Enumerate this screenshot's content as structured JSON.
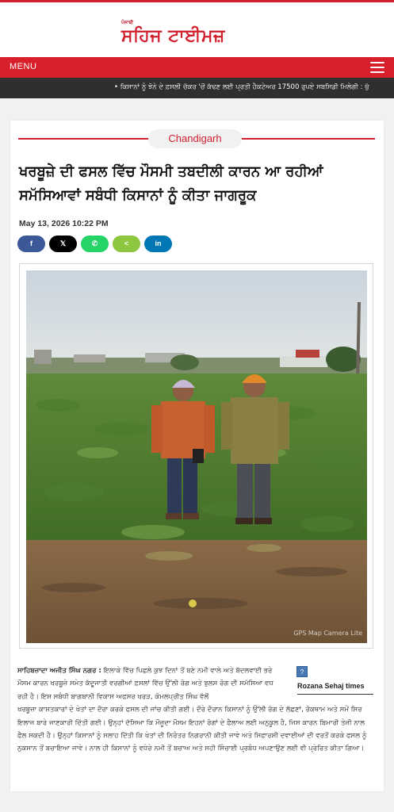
{
  "brand": {
    "small_label": "ਪੰਜਾਬੀ",
    "name": "ਸਹਿਜ ਟਾਈਮਜ਼",
    "accent_color": "#d0202e"
  },
  "menubar": {
    "menu_label": "MENU",
    "menu_icon": "hamburger-icon"
  },
  "ticker": {
    "text": "•  ਕਿਸਾਨਾਂ ਨੂੰ ਝੋਨੇ ਦੇ ਫ਼ਸਲੀ ਚੱਕਰ 'ਚੋਂ ਕੱਢਣ ਲਈ ਪ੍ਰਤੀ ਹੈਕਟੇਅਰ 17500 ਰੁਪਏ ਸਬਸਿਡੀ ਮਿਲੇਗੀ : ਖੁੱ"
  },
  "article": {
    "category": "Chandigarh",
    "headline": "ਖਰਬੂਜ਼ੇ ਦੀ ਫਸਲ ਵਿੱਚ ਮੌਸਮੀ ਤਬਦੀਲੀ ਕਾਰਨ ਆ ਰਹੀਆਂ ਸਮੱਸਿਆਵਾਂ ਸਬੰਧੀ ਕਿਸਾਨਾਂ ਨੂੰ ਕੀਤਾ ਜਾਗਰੂਕ",
    "date": "May 13, 2026 10:22 PM",
    "share": {
      "facebook": "f",
      "x": "𝕏",
      "whatsapp": "✆",
      "sharethis": "<",
      "linkedin": "in"
    },
    "photo_watermark": "GPS Map Camera Lite",
    "dateline": "ਸਾਹਿਬਜ਼ਾਦਾ ਅਜੀਤ ਸਿੰਘ ਨਗਰ :",
    "body_first": " ਇਲਾਕੇ ਵਿੱਚ ਪਿਛਲੇ ਕੁਝ ਦਿਨਾਂ ਤੋਂ ਬਣੇ ਨਮੀ ਵਾਲੇ ਅਤੇ ਬੱਦਲਵਾਈ ਭਰੇ ਮੌਸਮ ਕਾਰਨ ਖਰਬੂਜ਼ੇ ਸਮੇਤ ਕੱਦੂਜਾਤੀ ਵਰਗੀਆਂ ਫ਼ਸਲਾਂ ਵਿੱਚ ਉੱਲੀ ਰੋਗ ਅਤੇ ਝੁਲਸ ਰੋਗ ਦੀ ਸਮੱਸਿਆ ਵਧ ਰਹੀ ਹੈ। ਇਸ ਸਬੰਧੀ ਬਾਗਬਾਨੀ ਵਿਕਾਸ ਅਫਸਰ ਖਰੜ, ਕੋਮਲਪ੍ਰੀਤ ਸਿੰਘ ਵੱਲੋਂ",
    "body_rest": "ਖਰਬੂਜ਼ਾ ਕਾਸ਼ਤਕਾਰਾਂ ਦੇ ਖੇਤਾਂ ਦਾ ਦੌਰਾ ਕਰਕੇ ਫਸਲ ਦੀ ਜਾਂਚ ਕੀਤੀ ਗਈ। ਦੌਰੇ ਦੌਰਾਨ ਕਿਸਾਨਾਂ ਨੂੰ ਉੱਲੀ ਰੋਗ ਦੇ ਲੱਛਣਾਂ, ਰੋਕਥਾਮ ਅਤੇ ਸਮੇਂ ਸਿਰ ਇਲਾਜ ਬਾਰੇ ਜਾਣਕਾਰੀ ਦਿੱਤੀ ਗਈ। ਉਨ੍ਹਾਂ ਦੱਸਿਆ ਕਿ ਮੌਜੂਦਾ ਮੌਸਮ ਇਹਨਾਂ ਰੋਗਾਂ ਦੇ ਫੈਲਾਅ ਲਈ ਅਨੁਕੂਲ ਹੈ, ਜਿਸ ਕਾਰਨ ਬਿਮਾਰੀ ਤੇਜ਼ੀ ਨਾਲ ਫੈਲ ਸਕਦੀ ਹੈ। ਉਨ੍ਹਾਂ ਕਿਸਾਨਾਂ ਨੂੰ ਸਲਾਹ ਦਿੱਤੀ ਕਿ ਖੇਤਾਂ ਦੀ ਨਿਰੰਤਰ ਨਿਗਰਾਨੀ ਕੀਤੀ ਜਾਵੇ ਅਤੇ ਸਿਫਾਰਸ਼ੀ ਦਵਾਈਆਂ ਦੀ ਵਰਤੋਂ ਕਰਕੇ ਫਸਲ ਨੂੰ ਨੁਕਸਾਨ ਤੋਂ ਬਚਾਇਆ ਜਾਵੇ। ਨਾਲ ਹੀ ਕਿਸਾਨਾਂ ਨੂੰ ਵਧੇਰੇ ਨਮੀ ਤੋਂ ਬਚਾਅ ਅਤੇ ਸਹੀ ਸਿੰਚਾਈ ਪ੍ਰਬੰਧ ਅਪਣਾਉਣ ਲਈ ਵੀ ਪ੍ਰੇਰਿਤ ਕੀਤਾ ਗਿਆ।",
    "source_icon": "?",
    "source_name": "Rozana Sehaj times"
  }
}
